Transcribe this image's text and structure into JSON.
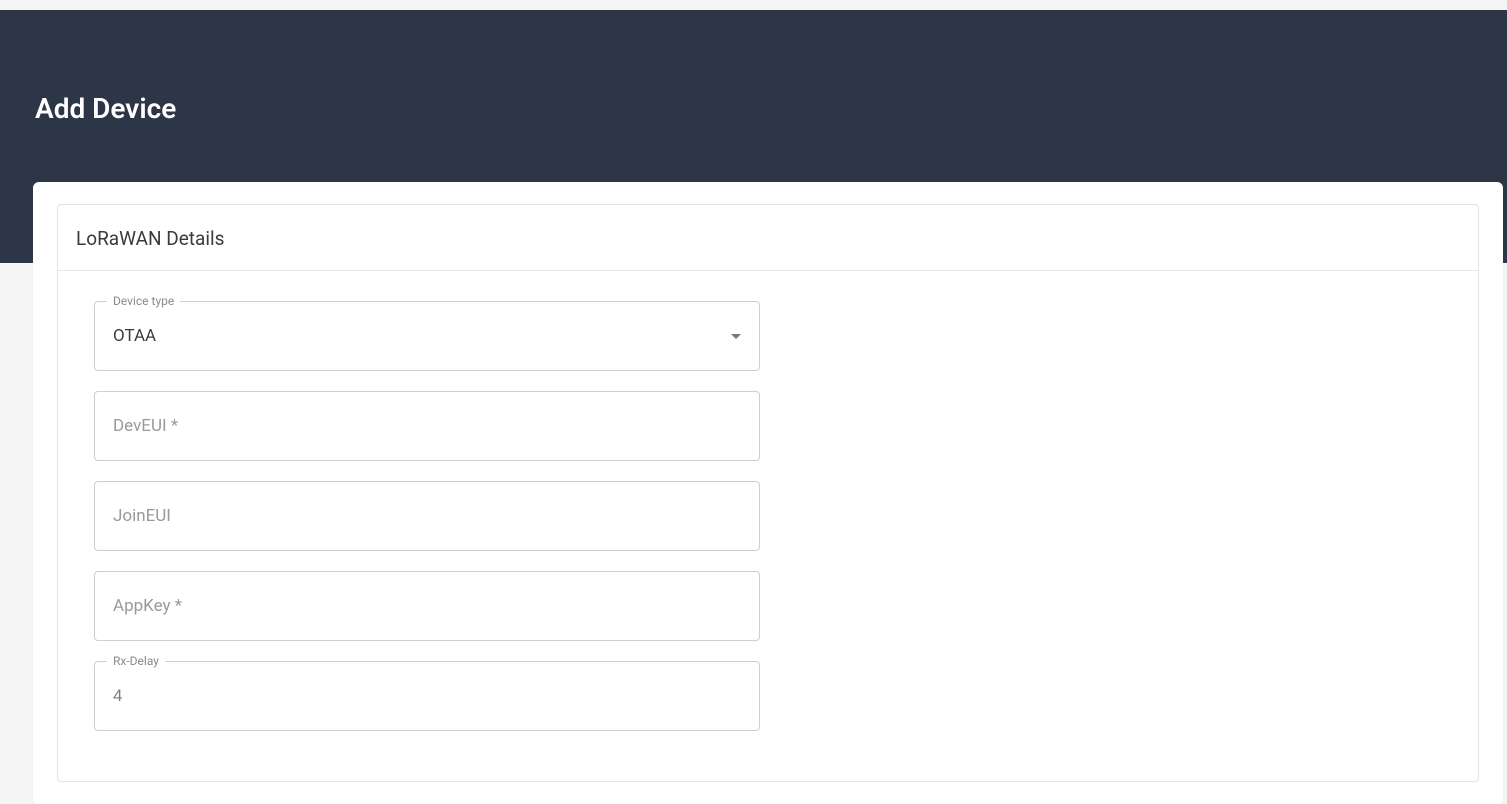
{
  "page": {
    "title": "Add Device"
  },
  "section": {
    "title": "LoRaWAN Details"
  },
  "fields": {
    "device_type": {
      "label": "Device type",
      "value": "OTAA"
    },
    "dev_eui": {
      "placeholder": "DevEUI *",
      "value": ""
    },
    "join_eui": {
      "placeholder": "JoinEUI",
      "value": ""
    },
    "app_key": {
      "placeholder": "AppKey *",
      "value": ""
    },
    "rx_delay": {
      "label": "Rx-Delay",
      "value": "4"
    }
  }
}
